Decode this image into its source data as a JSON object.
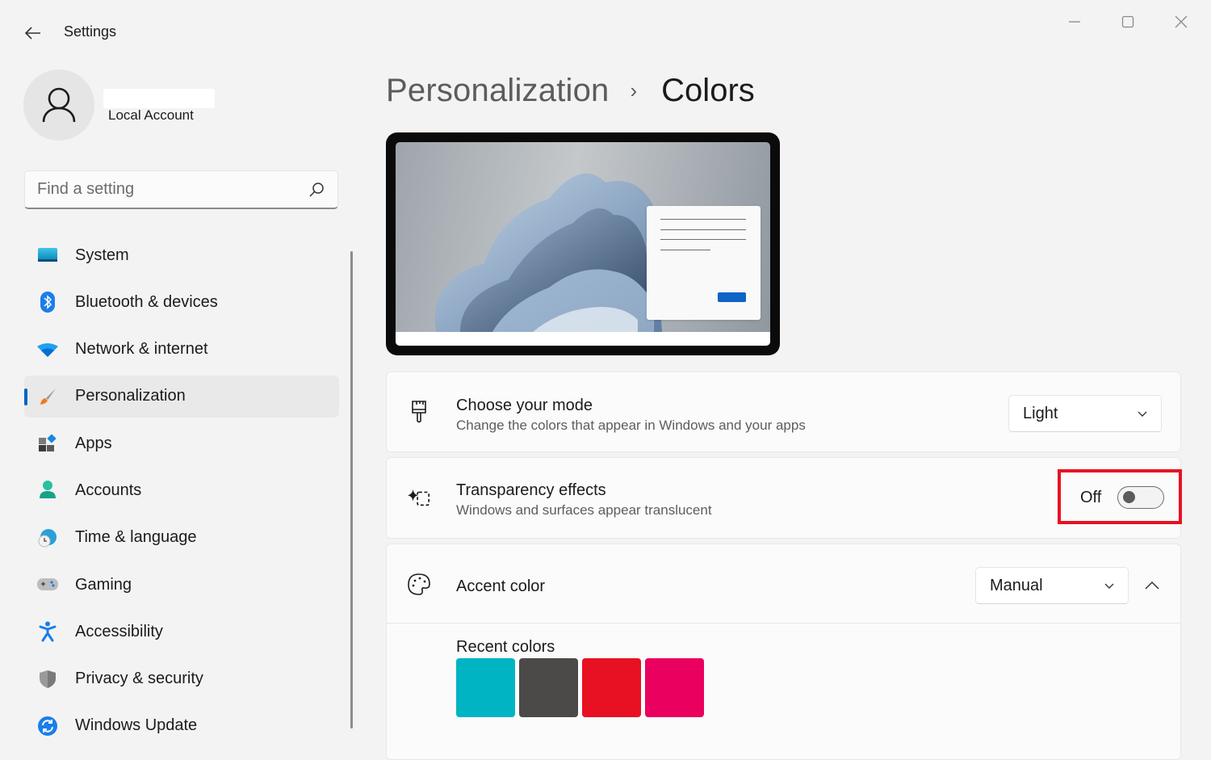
{
  "window": {
    "app_title": "Settings",
    "controls": {
      "minimize": "minimize",
      "maximize": "maximize",
      "close": "close"
    }
  },
  "account": {
    "name": "",
    "type": "Local Account"
  },
  "search": {
    "placeholder": "Find a setting",
    "value": ""
  },
  "sidebar": {
    "items": [
      {
        "label": "System",
        "icon": "system-icon",
        "active": false
      },
      {
        "label": "Bluetooth & devices",
        "icon": "bluetooth-icon",
        "active": false
      },
      {
        "label": "Network & internet",
        "icon": "wifi-icon",
        "active": false
      },
      {
        "label": "Personalization",
        "icon": "paintbrush-icon",
        "active": true
      },
      {
        "label": "Apps",
        "icon": "apps-icon",
        "active": false
      },
      {
        "label": "Accounts",
        "icon": "accounts-icon",
        "active": false
      },
      {
        "label": "Time & language",
        "icon": "time-language-icon",
        "active": false
      },
      {
        "label": "Gaming",
        "icon": "gamepad-icon",
        "active": false
      },
      {
        "label": "Accessibility",
        "icon": "accessibility-icon",
        "active": false
      },
      {
        "label": "Privacy & security",
        "icon": "shield-icon",
        "active": false
      },
      {
        "label": "Windows Update",
        "icon": "windows-update-icon",
        "active": false
      }
    ]
  },
  "breadcrumb": {
    "parent": "Personalization",
    "separator": "›",
    "current": "Colors"
  },
  "settings": {
    "mode": {
      "title": "Choose your mode",
      "subtitle": "Change the colors that appear in Windows and your apps",
      "value": "Light"
    },
    "transparency": {
      "title": "Transparency effects",
      "subtitle": "Windows and surfaces appear translucent",
      "state_label": "Off",
      "enabled": false
    },
    "accent": {
      "title": "Accent color",
      "value": "Manual",
      "expanded": true,
      "recent_label": "Recent colors",
      "recent_colors": [
        "#00b4c4",
        "#4c4a48",
        "#e81123",
        "#ea005e"
      ]
    }
  },
  "colors": {
    "accent": "#0067c0",
    "highlight_box": "#e81123"
  }
}
